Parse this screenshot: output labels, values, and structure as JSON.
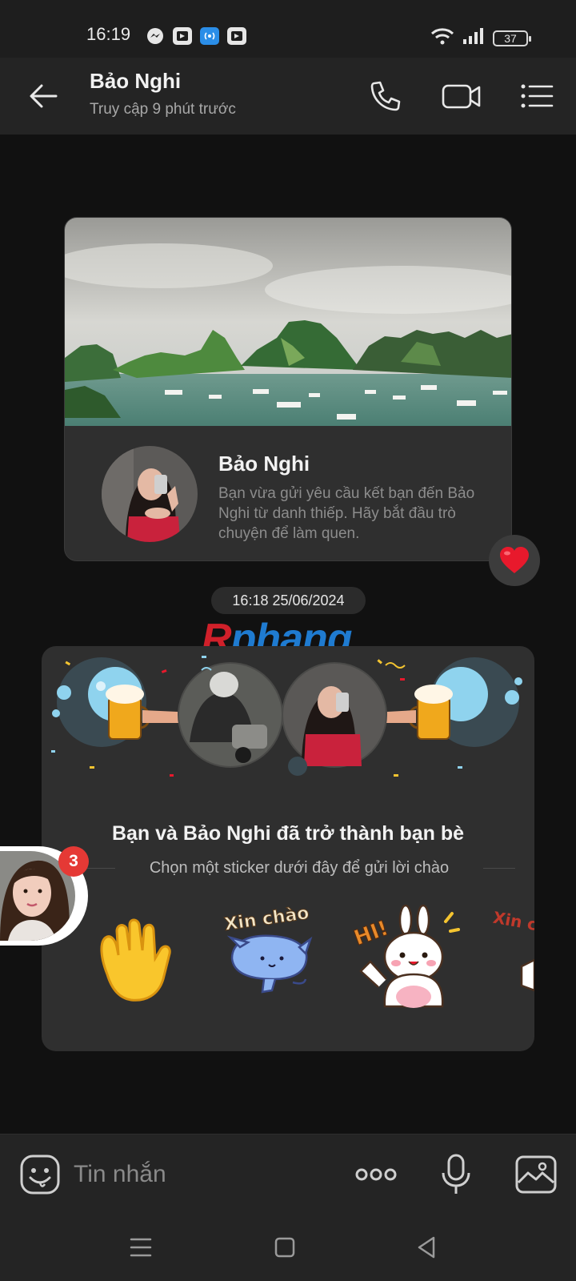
{
  "status_bar": {
    "time": "16:19",
    "battery": "37",
    "notification_icons": [
      "messenger-icon",
      "app-icon",
      "hotspot-icon",
      "app-icon"
    ]
  },
  "header": {
    "contact_name": "Bảo Nghi",
    "last_seen": "Truy cập 9 phút trước",
    "actions": [
      "phone-call-icon",
      "video-call-icon",
      "menu-icon"
    ]
  },
  "profile_card": {
    "name": "Bảo Nghi",
    "description": "Bạn vừa gửi yêu cầu kết bạn đến Bảo Nghi từ danh thiếp. Hãy bắt đầu trò chuyện để làm quen.",
    "reaction": "heart"
  },
  "timestamp": "16:18 25/06/2024",
  "watermark": {
    "part1": "R",
    "part2": "phang"
  },
  "friend_card": {
    "title": "Bạn và Bảo Nghi đã trở thành bạn bè",
    "subtitle": "Chọn một sticker dưới đây để gửi lời chào",
    "stickers": [
      {
        "name": "wave-hand"
      },
      {
        "name": "xin-chao-cat",
        "text": "Xin chào"
      },
      {
        "name": "hi-bunny",
        "text": "HI!"
      },
      {
        "name": "xin-chao-partial",
        "text": "Xin chà"
      }
    ]
  },
  "chat_head": {
    "badge": "3"
  },
  "composer": {
    "placeholder": "Tin nhắn"
  },
  "colors": {
    "background": "#111111",
    "bar": "#242424",
    "card": "#2f2f2f",
    "badge": "#e53935",
    "heart": "#e8192c"
  }
}
